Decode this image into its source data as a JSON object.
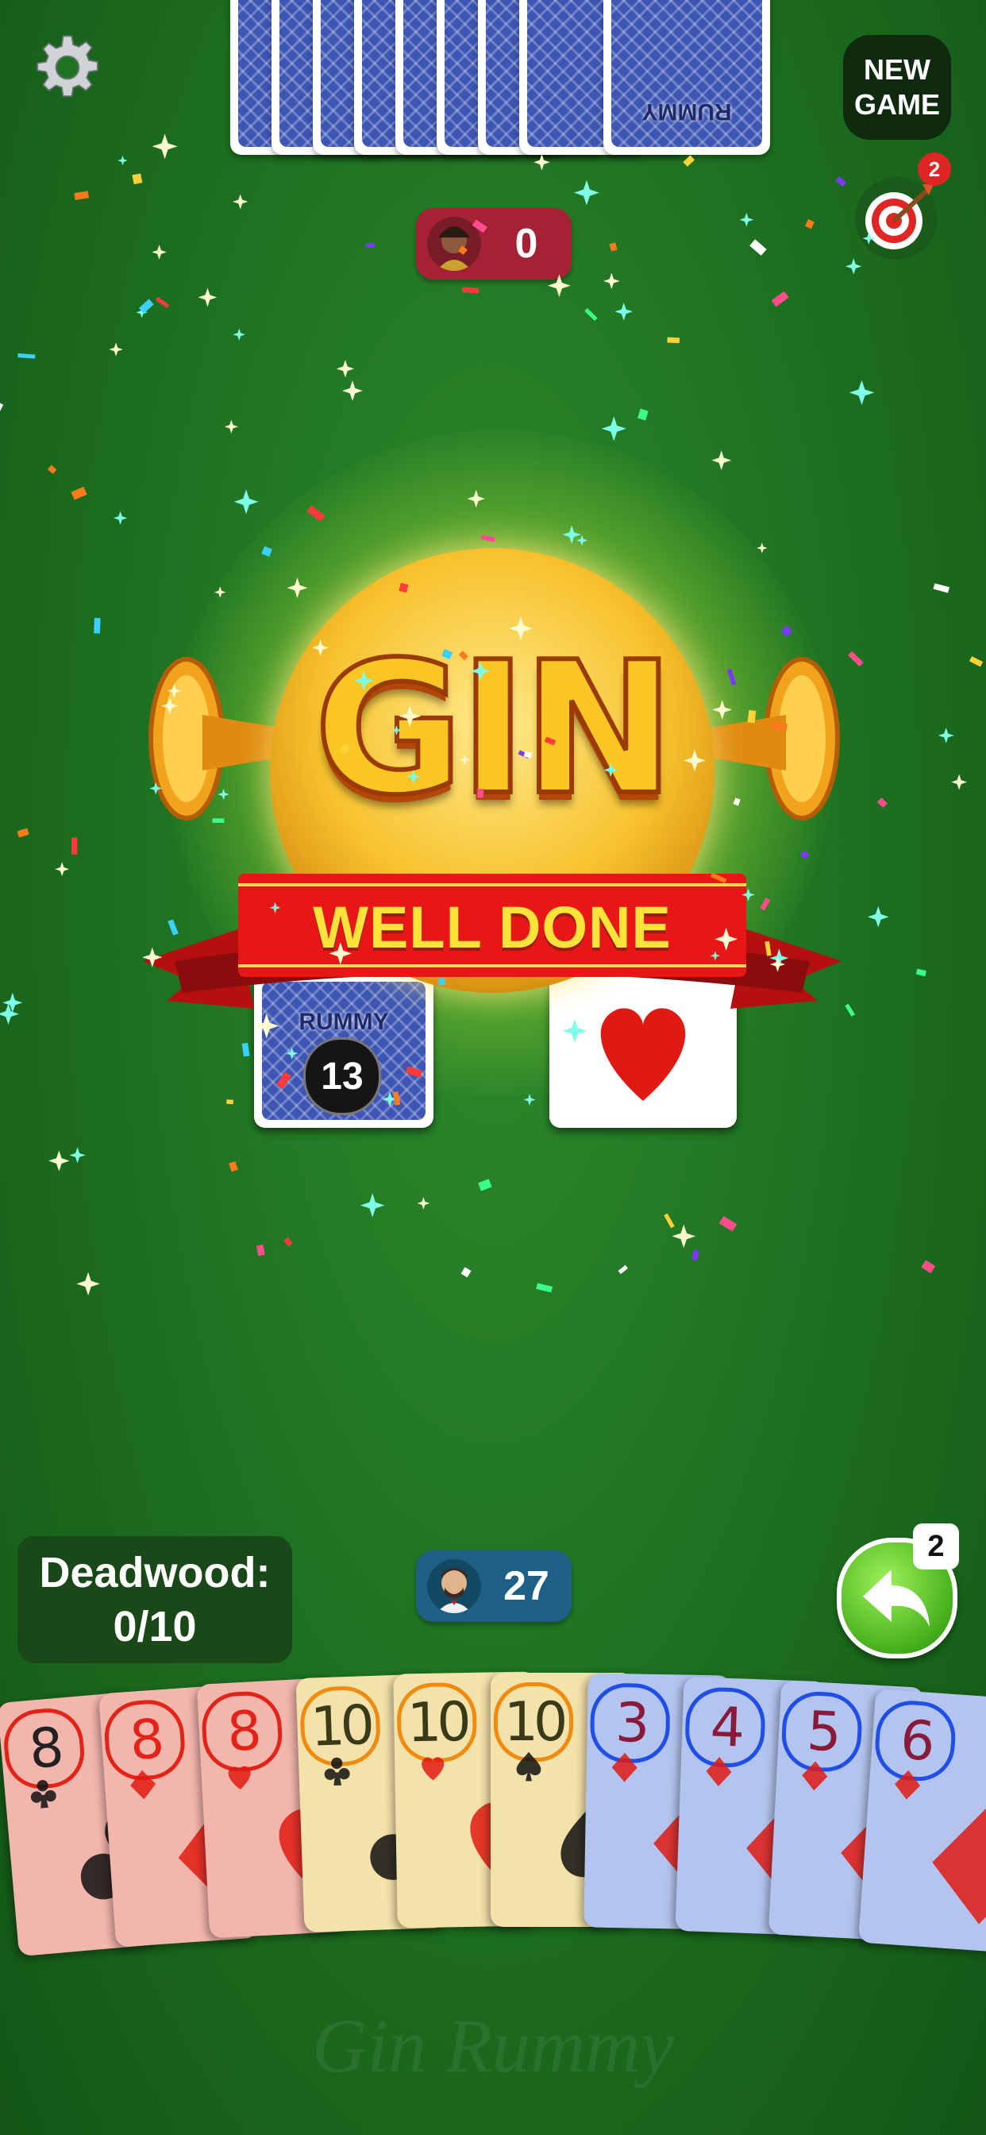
{
  "opponent": {
    "score": "0",
    "card_back_label": "RUMMY"
  },
  "player": {
    "score": "27"
  },
  "top_bar": {
    "new_game_line1": "NEW",
    "new_game_line2": "GAME",
    "target_badge": "2"
  },
  "banner": {
    "title": "GIN",
    "subtitle": "WELL DONE"
  },
  "deck": {
    "label": "RUMMY",
    "remaining": "13"
  },
  "deadwood": {
    "label": "Deadwood:",
    "value": "0/10"
  },
  "undo": {
    "count": "2"
  },
  "hand": [
    {
      "rank": "8",
      "suit": "clubs",
      "suit_color": "#111111",
      "tint": "#f3b6ad",
      "ring": "#e32318"
    },
    {
      "rank": "8",
      "suit": "diamonds",
      "suit_color": "#e01a12",
      "tint": "#f3b6ad",
      "ring": "#e32318"
    },
    {
      "rank": "8",
      "suit": "hearts",
      "suit_color": "#e01a12",
      "tint": "#f3b6ad",
      "ring": "#e32318"
    },
    {
      "rank": "10",
      "suit": "clubs",
      "suit_color": "#111111",
      "tint": "#f4e2ab",
      "ring": "#f08b12"
    },
    {
      "rank": "10",
      "suit": "hearts",
      "suit_color": "#e01a12",
      "tint": "#f4e2ab",
      "ring": "#f08b12"
    },
    {
      "rank": "10",
      "suit": "spades",
      "suit_color": "#111111",
      "tint": "#f4e2ab",
      "ring": "#f08b12"
    },
    {
      "rank": "3",
      "suit": "diamonds",
      "suit_color": "#e01a12",
      "tint": "#b3c4ee",
      "ring": "#1f4fe8"
    },
    {
      "rank": "4",
      "suit": "diamonds",
      "suit_color": "#e01a12",
      "tint": "#b3c4ee",
      "ring": "#1f4fe8"
    },
    {
      "rank": "5",
      "suit": "diamonds",
      "suit_color": "#e01a12",
      "tint": "#b3c4ee",
      "ring": "#1f4fe8"
    },
    {
      "rank": "6",
      "suit": "diamonds",
      "suit_color": "#e01a12",
      "tint": "#b3c4ee",
      "ring": "#1f4fe8"
    }
  ],
  "watermark": "Gin Rummy",
  "colors": {
    "felt": "#1f7422",
    "opp_pill": "#a52235",
    "player_pill": "#1d5f86",
    "ribbon": "#e81717",
    "gold": "#f9c623"
  }
}
